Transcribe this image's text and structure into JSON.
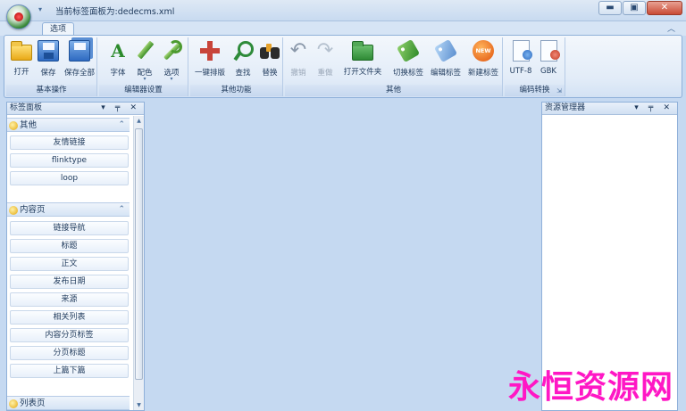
{
  "window": {
    "title": "当前标签面板为:dedecms.xml",
    "controls": {
      "minimize": "▬",
      "maximize": "▣",
      "close": "✕"
    }
  },
  "ribbon": {
    "tab": "选项",
    "collapse_glyph": "︿",
    "groups": [
      {
        "label": "基本操作",
        "buttons": [
          {
            "label": "打开",
            "icon": "open-folder-icon"
          },
          {
            "label": "保存",
            "icon": "save-disk-icon"
          },
          {
            "label": "保存全部",
            "icon": "save-all-disks-icon"
          }
        ]
      },
      {
        "label": "编辑器设置",
        "buttons": [
          {
            "label": "字体",
            "icon": "font-letter-a-icon"
          },
          {
            "label": "配色",
            "icon": "pencil-icon"
          },
          {
            "label": "选项",
            "icon": "wrench-icon"
          }
        ]
      },
      {
        "label": "其他功能",
        "buttons": [
          {
            "label": "一键排版",
            "icon": "move-arrows-icon"
          },
          {
            "label": "查找",
            "icon": "magnifier-icon"
          },
          {
            "label": "替换",
            "icon": "binoculars-icon"
          }
        ]
      },
      {
        "label": "其他",
        "buttons": [
          {
            "label": "撤销",
            "icon": "undo-icon",
            "disabled": true
          },
          {
            "label": "重做",
            "icon": "redo-icon",
            "disabled": true
          },
          {
            "label": "打开文件夹",
            "icon": "green-folder-icon"
          },
          {
            "label": "切换标签",
            "icon": "green-tag-icon"
          },
          {
            "label": "编辑标签",
            "icon": "blue-tag-icon"
          },
          {
            "label": "新建标签",
            "icon": "new-badge-icon",
            "badge_text": "NEW"
          }
        ]
      },
      {
        "label": "编码转换",
        "buttons": [
          {
            "label": "UTF-8",
            "icon": "utf8-document-icon"
          },
          {
            "label": "GBK",
            "icon": "gbk-document-icon"
          }
        ]
      }
    ]
  },
  "left_panel": {
    "title": "标签面板",
    "tools": "▾ ╤ ✕",
    "sections": [
      {
        "title": "其他",
        "items": [
          "友情链接",
          "flinktype",
          "loop"
        ]
      },
      {
        "title": "内容页",
        "items": [
          "链接导航",
          "标题",
          "正文",
          "发布日期",
          "来源",
          "相关列表",
          "内容分页标签",
          "分页标题",
          "上篇下篇"
        ]
      },
      {
        "title": "列表页",
        "items": []
      }
    ]
  },
  "right_panel": {
    "title": "资源管理器",
    "tools": "▾ ╤ ✕"
  },
  "watermark": "永恒资源网"
}
